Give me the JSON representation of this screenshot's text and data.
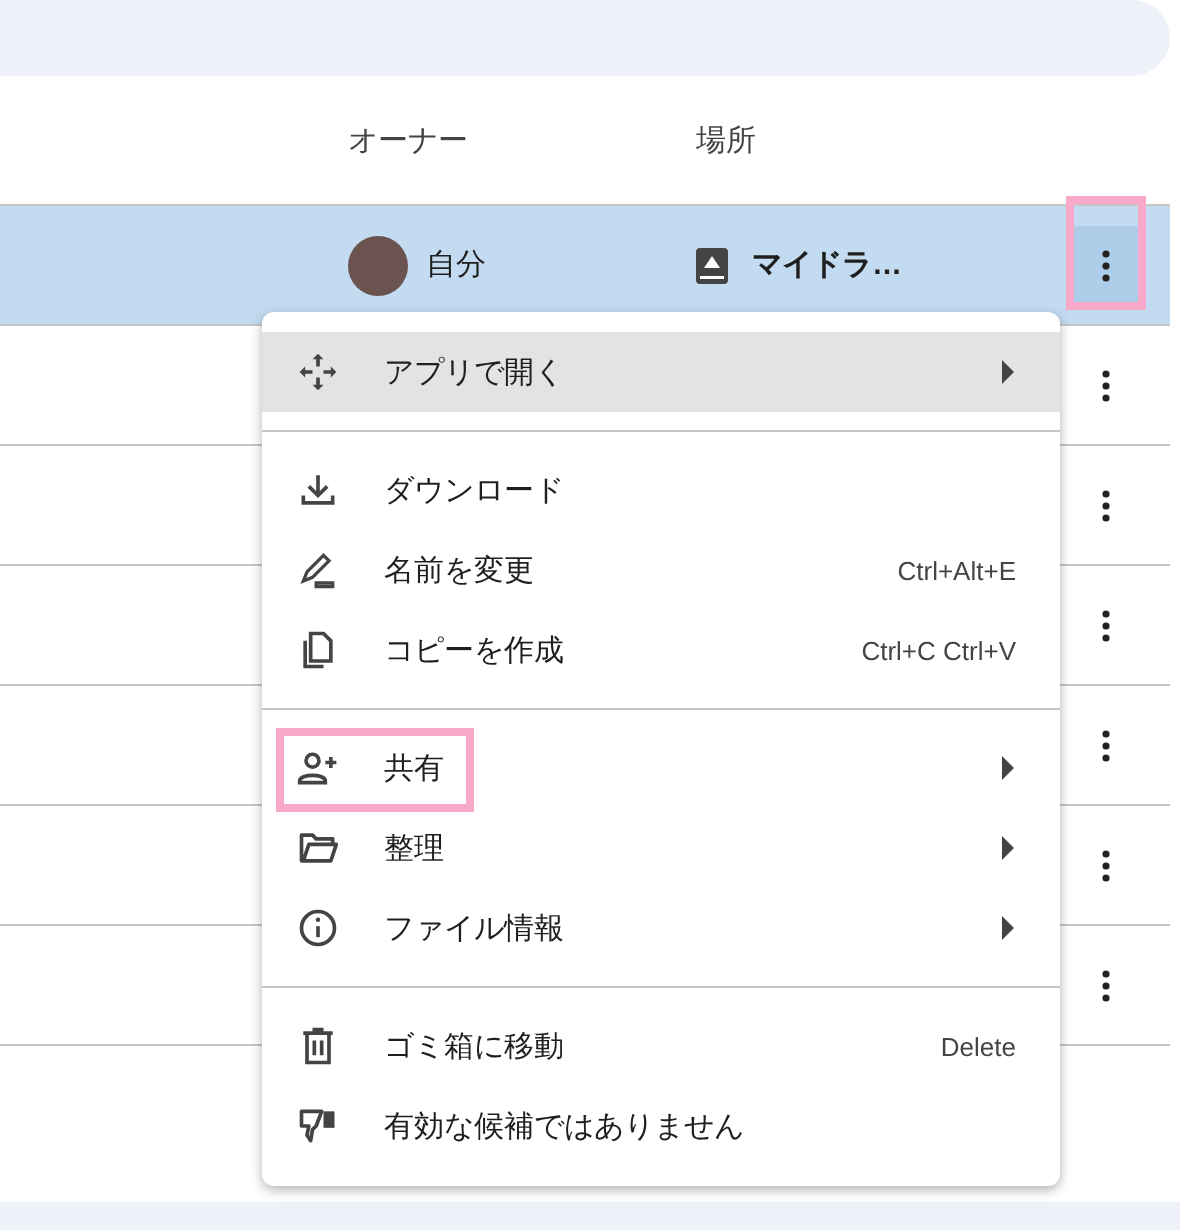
{
  "table": {
    "columns": [
      {
        "label": "オーナー"
      },
      {
        "label": "場所"
      }
    ],
    "rows": [
      {
        "owner": "自分",
        "location": "マイドラ…",
        "selected": true,
        "highlighted": true
      },
      {
        "selected": false,
        "highlighted": false
      },
      {
        "selected": false,
        "highlighted": false
      },
      {
        "selected": false,
        "highlighted": false
      },
      {
        "selected": false,
        "highlighted": false
      },
      {
        "selected": false,
        "highlighted": false
      },
      {
        "selected": false,
        "highlighted": false
      }
    ]
  },
  "context_menu": {
    "items": [
      {
        "kind": "item",
        "label": "アプリで開く",
        "submenu": true,
        "hovered": true,
        "highlighted": false
      },
      {
        "kind": "divider"
      },
      {
        "kind": "item",
        "label": "ダウンロード",
        "submenu": false,
        "hovered": false,
        "highlighted": false
      },
      {
        "kind": "item",
        "label": "名前を変更",
        "shortcut": "Ctrl+Alt+E",
        "submenu": false,
        "hovered": false,
        "highlighted": false
      },
      {
        "kind": "item",
        "label": "コピーを作成",
        "shortcut": "Ctrl+C Ctrl+V",
        "submenu": false,
        "hovered": false,
        "highlighted": false
      },
      {
        "kind": "divider"
      },
      {
        "kind": "item",
        "label": "共有",
        "submenu": true,
        "hovered": false,
        "highlighted": true
      },
      {
        "kind": "item",
        "label": "整理",
        "submenu": true,
        "hovered": false,
        "highlighted": false
      },
      {
        "kind": "item",
        "label": "ファイル情報",
        "submenu": true,
        "hovered": false,
        "highlighted": false
      },
      {
        "kind": "divider"
      },
      {
        "kind": "item",
        "label": "ゴミ箱に移動",
        "shortcut": "Delete",
        "submenu": false,
        "hovered": false,
        "highlighted": false
      },
      {
        "kind": "item",
        "label": "有効な候補ではありません",
        "submenu": false,
        "hovered": false,
        "highlighted": false
      }
    ]
  }
}
